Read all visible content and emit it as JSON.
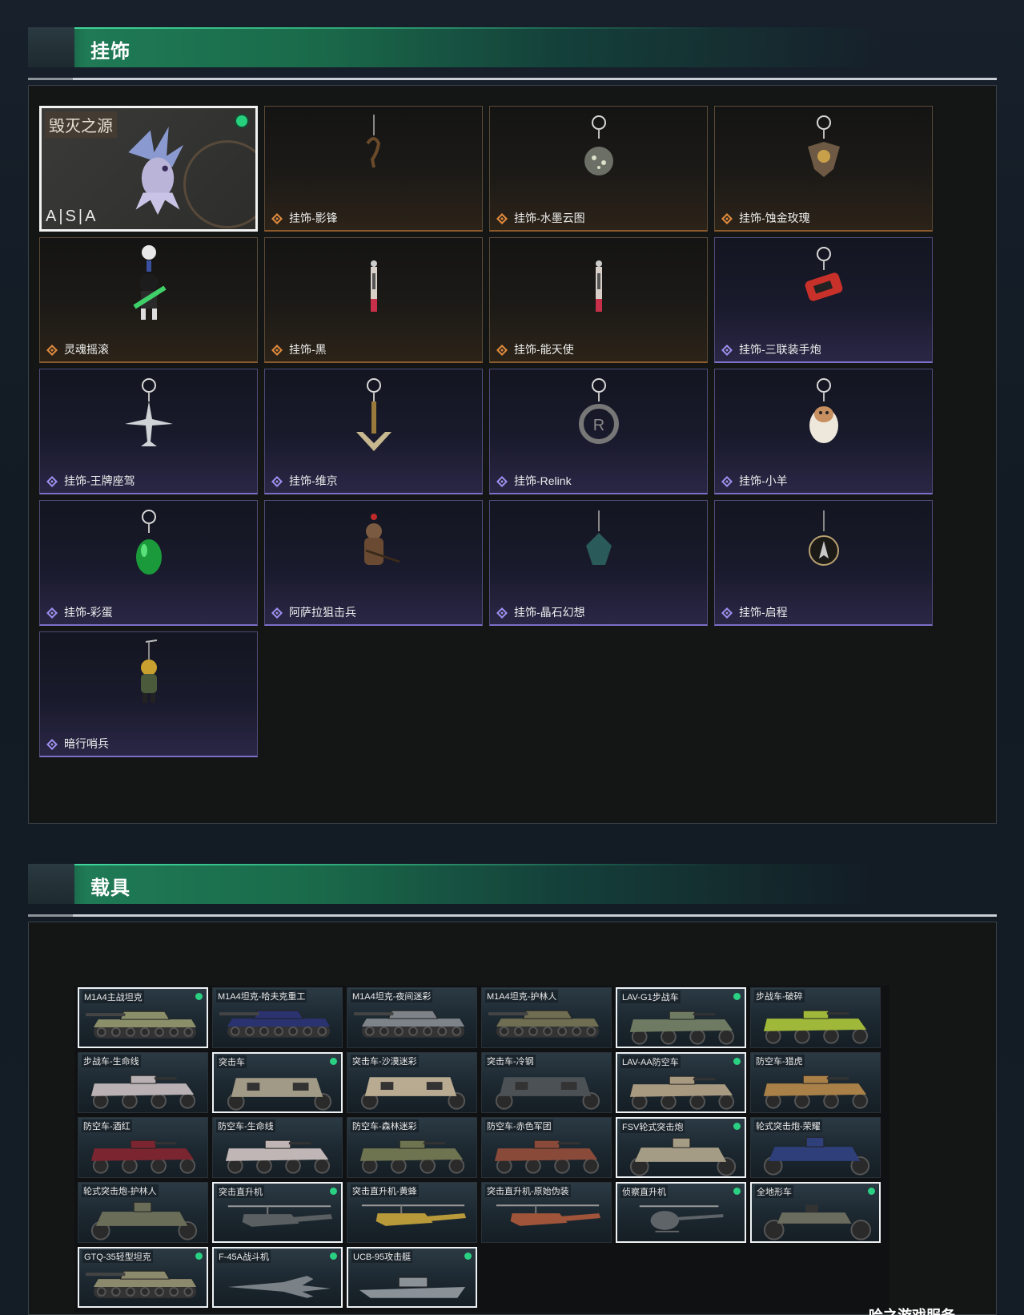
{
  "sections": {
    "charms_title": "挂饰",
    "vehicles_title": "载具"
  },
  "featured": {
    "name": "毁灭之源",
    "brand": "A|S|A"
  },
  "charms": [
    {
      "label": "挂饰-影锋",
      "rarity": "orange",
      "icon": "hook-charm"
    },
    {
      "label": "挂饰-水墨云图",
      "rarity": "orange",
      "icon": "orb-charm"
    },
    {
      "label": "挂饰-蚀金玫瑰",
      "rarity": "orange",
      "icon": "rose-emblem-charm"
    },
    {
      "label": "灵魂摇滚",
      "rarity": "orange",
      "icon": "guitar-figure-charm"
    },
    {
      "label": "挂饰-黑",
      "rarity": "orange",
      "icon": "stick-charm"
    },
    {
      "label": "挂饰-能天使",
      "rarity": "orange",
      "icon": "stick-charm"
    },
    {
      "label": "挂饰-三联装手炮",
      "rarity": "purple",
      "icon": "cannon-charm"
    },
    {
      "label": "挂饰-王牌座驾",
      "rarity": "purple",
      "icon": "jet-charm"
    },
    {
      "label": "挂饰-维京",
      "rarity": "purple",
      "icon": "anchor-charm"
    },
    {
      "label": "挂饰-Relink",
      "rarity": "purple",
      "icon": "relink-logo-charm"
    },
    {
      "label": "挂饰-小羊",
      "rarity": "purple",
      "icon": "sheep-charm"
    },
    {
      "label": "挂饰-彩蛋",
      "rarity": "purple",
      "icon": "egg-charm"
    },
    {
      "label": "阿萨拉狙击兵",
      "rarity": "purple",
      "icon": "sniper-figure-charm"
    },
    {
      "label": "挂饰-晶石幻想",
      "rarity": "purple",
      "icon": "crystal-charm"
    },
    {
      "label": "挂饰-启程",
      "rarity": "purple",
      "icon": "medal-charm"
    },
    {
      "label": "暗行哨兵",
      "rarity": "purple",
      "icon": "sentinel-figure-charm"
    }
  ],
  "vehicles": [
    {
      "label": "M1A4主战坦克",
      "type": "tank",
      "owned": true,
      "color": "#8a8f6a"
    },
    {
      "label": "M1A4坦克-哈夫克重工",
      "type": "tank",
      "owned": false,
      "color": "#2a3270"
    },
    {
      "label": "M1A4坦克-夜间迷彩",
      "type": "tank",
      "owned": false,
      "color": "#7d8388"
    },
    {
      "label": "M1A4坦克-护林人",
      "type": "tank",
      "owned": false,
      "color": "#6f6e52"
    },
    {
      "label": "LAV-G1步战车",
      "type": "apc",
      "owned": true,
      "color": "#6f7a62"
    },
    {
      "label": "步战车-破碎",
      "type": "apc",
      "owned": false,
      "color": "#9fb83a"
    },
    {
      "label": "步战车-生命线",
      "type": "apc",
      "owned": false,
      "color": "#b9b1b3"
    },
    {
      "label": "突击车",
      "type": "truck",
      "owned": true,
      "color": "#a09a86"
    },
    {
      "label": "突击车-沙漠迷彩",
      "type": "truck",
      "owned": false,
      "color": "#b8ab92"
    },
    {
      "label": "突击车-冷钢",
      "type": "truck",
      "owned": false,
      "color": "#4c5156"
    },
    {
      "label": "LAV-AA防空车",
      "type": "apc",
      "owned": true,
      "color": "#a89a80"
    },
    {
      "label": "防空车-猎虎",
      "type": "apc",
      "owned": false,
      "color": "#a88048"
    },
    {
      "label": "防空车-酒红",
      "type": "apc",
      "owned": false,
      "color": "#7a2530"
    },
    {
      "label": "防空车-生命线",
      "type": "apc",
      "owned": false,
      "color": "#c0b6b6"
    },
    {
      "label": "防空车-森林迷彩",
      "type": "apc",
      "owned": false,
      "color": "#6e7450"
    },
    {
      "label": "防空车-赤色军团",
      "type": "apc",
      "owned": false,
      "color": "#8a4a3a"
    },
    {
      "label": "FSV轮式突击炮",
      "type": "buggy",
      "owned": true,
      "color": "#a59c86"
    },
    {
      "label": "轮式突击炮-荣耀",
      "type": "buggy",
      "owned": false,
      "color": "#2e3f7a"
    },
    {
      "label": "轮式突击炮-护林人",
      "type": "buggy",
      "owned": false,
      "color": "#6a6e58"
    },
    {
      "label": "突击直升机",
      "type": "heli",
      "owned": true,
      "color": "#5a6062"
    },
    {
      "label": "突击直升机-黄蜂",
      "type": "heli",
      "owned": false,
      "color": "#b89a3a"
    },
    {
      "label": "突击直升机-原始伪装",
      "type": "heli",
      "owned": false,
      "color": "#a0553a"
    },
    {
      "label": "侦察直升机",
      "type": "scout",
      "owned": true,
      "color": "#5e6468"
    },
    {
      "label": "全地形车",
      "type": "atv",
      "owned": true,
      "color": "#6a6c5e"
    },
    {
      "label": "GTQ-35轻型坦克",
      "type": "tank",
      "owned": true,
      "color": "#8c8a6c"
    },
    {
      "label": "F-45A战斗机",
      "type": "jet",
      "owned": true,
      "color": "#7a8288"
    },
    {
      "label": "UCB-95攻击艇",
      "type": "boat",
      "owned": true,
      "color": "#8a9298"
    }
  ],
  "watermark": "哈之游戏服务",
  "colors": {
    "accent_green": "#26d07c",
    "orange_rarity": "#e08a3c",
    "purple_rarity": "#9a8ef0"
  }
}
